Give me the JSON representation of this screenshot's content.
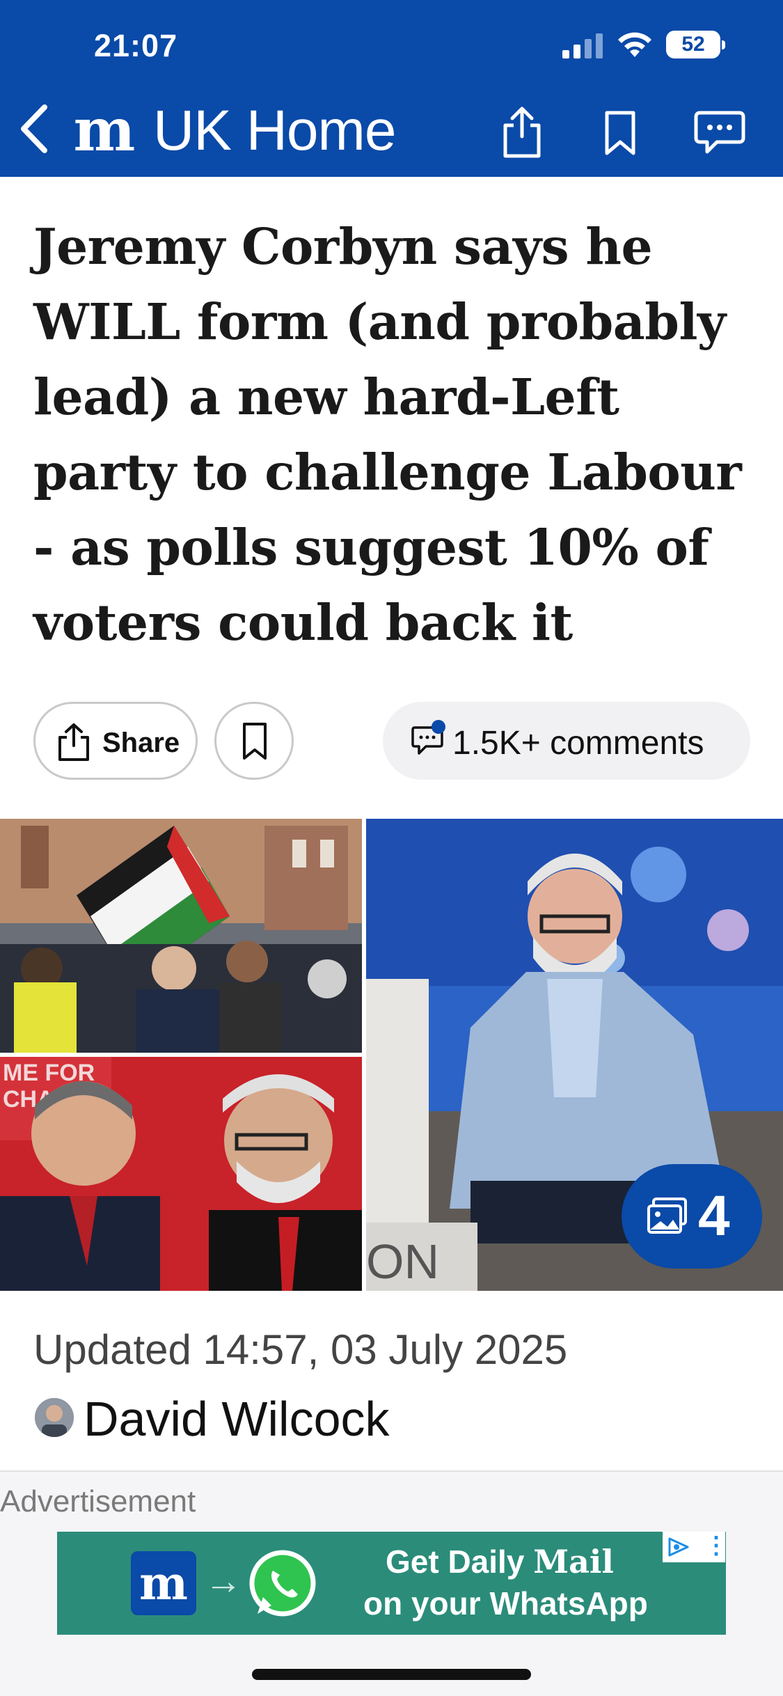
{
  "status_bar": {
    "time": "21:07",
    "battery_level": "52"
  },
  "nav": {
    "logo_text": "m",
    "title": "UK Home",
    "icons": [
      "back-chevron-icon",
      "share-icon",
      "bookmark-icon",
      "comment-icon"
    ]
  },
  "article": {
    "headline": "Jeremy Corbyn says he WILL form (and probably lead) a new hard-Left party to challenge Labour - as polls suggest 10% of voters could back it",
    "share_label": "Share",
    "comments_label": "1.5K+ comments",
    "gallery_count": "4",
    "updated": "Updated 14:57, 03 July 2025",
    "author": "David Wilcock"
  },
  "advert": {
    "label": "Advertisement",
    "logo_text": "m",
    "line1_prefix": "Get Daily ",
    "line1_brand": "Mail",
    "line2": "on your WhatsApp",
    "photo_caption_fragment_1": "ME FOR",
    "photo_caption_fragment_2": "CHA",
    "photo_caption_fragment_3": "ON"
  },
  "colors": {
    "brand_blue": "#0a4aa8",
    "headline_text": "#1a1a1a",
    "ad_green": "#2b8c7a"
  }
}
